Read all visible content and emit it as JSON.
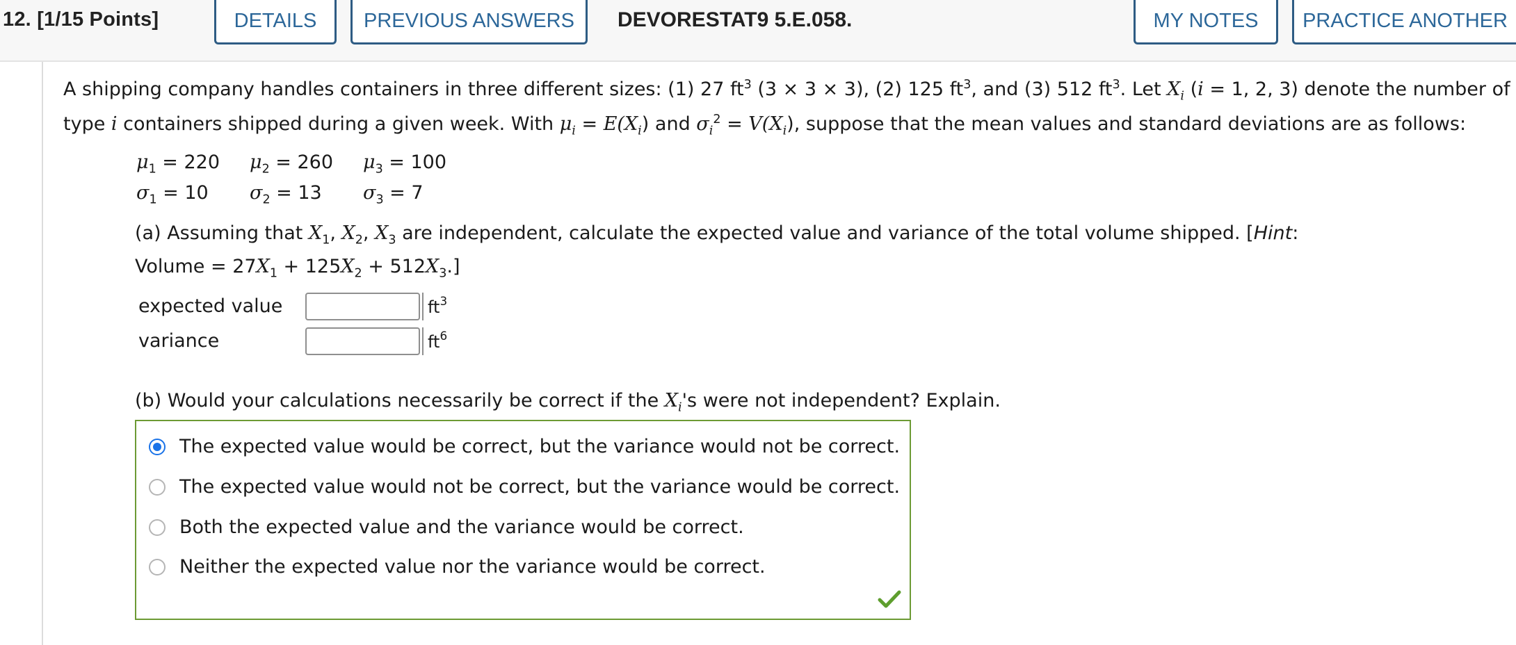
{
  "header": {
    "question_number": "12.",
    "points": "[1/15 Points]",
    "details_label": "DETAILS",
    "previous_answers_label": "PREVIOUS ANSWERS",
    "question_code": "DEVORESTAT9 5.E.058.",
    "my_notes_label": "MY NOTES",
    "practice_another_label": "PRACTICE ANOTHER"
  },
  "problem": {
    "l1_a": "A shipping company handles containers in three different sizes: (1) 27 ft",
    "l1_b": " (3 × 3 × 3), (2) 125 ft",
    "l1_c": ", and (3) 512 ft",
    "l1_d": ". Let ",
    "l1_e": " (",
    "l1_f": " = 1, 2, 3) denote the number of",
    "l2_a": "type ",
    "l2_b": " containers shipped during a given week. With ",
    "l2_c": " = ",
    "l2_d": " and ",
    "l2_e": " = ",
    "l2_f": ", suppose that the mean values and standard deviations are as follows:",
    "exp3": "3",
    "exp2": "2",
    "sym_X": "X",
    "sym_i": "i",
    "sym_mu": "μ",
    "sym_sigma": "σ",
    "sym_E": "E(X",
    "sym_V": "V(X",
    "close_paren": ")"
  },
  "parameters": {
    "mu1": " = 220",
    "mu2": " = 260",
    "mu3": " = 100",
    "s1": " = 10",
    "s2": " = 13",
    "s3": " = 7",
    "sub1": "1",
    "sub2": "2",
    "sub3": "3"
  },
  "part_a": {
    "t1": "(a) Assuming that ",
    "t2": ", ",
    "t3": " are independent, calculate the expected value and variance of the total volume shipped. [",
    "hint": "Hint",
    "t4": ":",
    "v1": "Volume = 27",
    "v2": " + 125",
    "v3": " + 512",
    "v4": ".]",
    "expected_label": "expected value",
    "expected_value": "",
    "expected_unit": "ft",
    "expected_unit_exp": "3",
    "variance_label": "variance",
    "variance_value": "",
    "variance_unit": "ft",
    "variance_unit_exp": "6"
  },
  "part_b": {
    "q1": "(b) Would your calculations necessarily be correct if the ",
    "q2": "'s were not independent? Explain.",
    "options": [
      "The expected value would be correct, but the variance would not be correct.",
      "The expected value would not be correct, but the variance would be correct.",
      "Both the expected value and the variance would be correct.",
      "Neither the expected value nor the variance would be correct."
    ],
    "selected_index": 0
  },
  "colors": {
    "accent": "#2c6799",
    "correct_border": "#6c9a34",
    "correct_check": "#5e9e2e",
    "radio_selected": "#1a73e8"
  },
  "icons": {
    "status": "checkmark-icon"
  }
}
